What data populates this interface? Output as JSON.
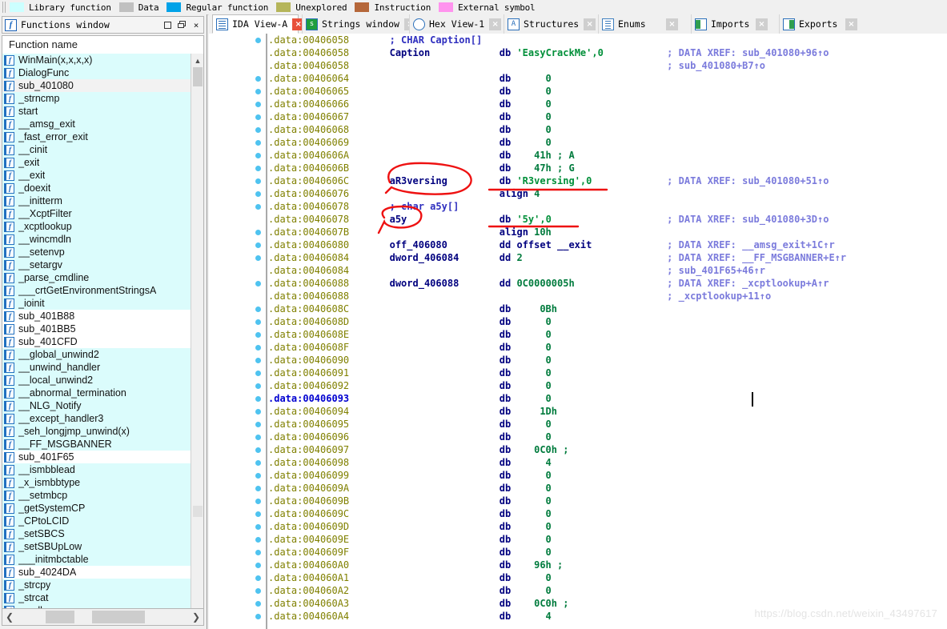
{
  "legend": {
    "items": [
      {
        "label": "Library function",
        "color": "#ccffff"
      },
      {
        "label": "Data",
        "color": "#c0c0c0"
      },
      {
        "label": "Regular function",
        "color": "#00a2e8"
      },
      {
        "label": "Unexplored",
        "color": "#b5b55a"
      },
      {
        "label": "Instruction",
        "color": "#b5673a"
      },
      {
        "label": "External symbol",
        "color": "#ff93ee"
      }
    ]
  },
  "functions_panel": {
    "title": "Functions window",
    "icon": "ida-f-icon",
    "window_buttons": [
      {
        "name": "maximize",
        "glyph": "square"
      },
      {
        "name": "restore",
        "glyph": "restore"
      },
      {
        "name": "close",
        "glyph": "×"
      }
    ],
    "column_header": "Function name",
    "rows": [
      {
        "name": "WinMain(x,x,x,x)",
        "kind": "lib"
      },
      {
        "name": "DialogFunc",
        "kind": "lib"
      },
      {
        "name": "sub_401080",
        "kind": "sel"
      },
      {
        "name": "_strncmp",
        "kind": "lib"
      },
      {
        "name": "start",
        "kind": "lib"
      },
      {
        "name": "__amsg_exit",
        "kind": "lib"
      },
      {
        "name": "_fast_error_exit",
        "kind": "lib"
      },
      {
        "name": "__cinit",
        "kind": "lib"
      },
      {
        "name": "_exit",
        "kind": "lib"
      },
      {
        "name": "__exit",
        "kind": "lib"
      },
      {
        "name": "_doexit",
        "kind": "lib"
      },
      {
        "name": "__initterm",
        "kind": "lib"
      },
      {
        "name": "__XcptFilter",
        "kind": "lib"
      },
      {
        "name": "_xcptlookup",
        "kind": "lib"
      },
      {
        "name": "__wincmdln",
        "kind": "lib"
      },
      {
        "name": "__setenvp",
        "kind": "lib"
      },
      {
        "name": "__setargv",
        "kind": "lib"
      },
      {
        "name": "_parse_cmdline",
        "kind": "lib"
      },
      {
        "name": "___crtGetEnvironmentStringsA",
        "kind": "lib"
      },
      {
        "name": "_ioinit",
        "kind": "lib"
      },
      {
        "name": "sub_401B88",
        "kind": "reg"
      },
      {
        "name": "sub_401BB5",
        "kind": "reg"
      },
      {
        "name": "sub_401CFD",
        "kind": "reg"
      },
      {
        "name": "__global_unwind2",
        "kind": "lib"
      },
      {
        "name": "__unwind_handler",
        "kind": "lib"
      },
      {
        "name": "__local_unwind2",
        "kind": "lib"
      },
      {
        "name": "__abnormal_termination",
        "kind": "lib"
      },
      {
        "name": "__NLG_Notify",
        "kind": "lib"
      },
      {
        "name": "__except_handler3",
        "kind": "lib"
      },
      {
        "name": "_seh_longjmp_unwind(x)",
        "kind": "lib"
      },
      {
        "name": "__FF_MSGBANNER",
        "kind": "lib"
      },
      {
        "name": "sub_401F65",
        "kind": "reg"
      },
      {
        "name": "__ismbblead",
        "kind": "lib"
      },
      {
        "name": "_x_ismbbtype",
        "kind": "lib"
      },
      {
        "name": "__setmbcp",
        "kind": "lib"
      },
      {
        "name": "_getSystemCP",
        "kind": "lib"
      },
      {
        "name": "_CPtoLCID",
        "kind": "lib"
      },
      {
        "name": "_setSBCS",
        "kind": "lib"
      },
      {
        "name": "_setSBUpLow",
        "kind": "lib"
      },
      {
        "name": "___initmbctable",
        "kind": "lib"
      },
      {
        "name": "sub_4024DA",
        "kind": "reg"
      },
      {
        "name": "_strcpy",
        "kind": "lib"
      },
      {
        "name": "_strcat",
        "kind": "lib"
      },
      {
        "name": "_malloc",
        "kind": "lib"
      }
    ]
  },
  "tabs": [
    {
      "label": "IDA View-A",
      "icon": "ico-doc",
      "active": true,
      "close": "×"
    },
    {
      "label": "Strings window",
      "icon": "ico-green",
      "active": false,
      "close": "×"
    },
    {
      "label": "Hex View-1",
      "icon": "ico-hex",
      "active": false,
      "close": "×"
    },
    {
      "label": "Structures",
      "icon": "ico-struct",
      "active": false,
      "close": "×"
    },
    {
      "label": "Enums",
      "icon": "ico-enum",
      "active": false,
      "close": "×"
    },
    {
      "label": "Imports",
      "icon": "ico-imp",
      "active": false,
      "close": "×"
    },
    {
      "label": "Exports",
      "icon": "ico-exp",
      "active": false,
      "close": "×"
    }
  ],
  "disassembly": {
    "lines": [
      {
        "dot": true,
        "addr": ".data:00406058",
        "label": "",
        "code": "; CHAR Caption[]",
        "code_class": "cmt",
        "xref": ""
      },
      {
        "dot": false,
        "addr": ".data:00406058",
        "label": "Caption",
        "mn": "db",
        "op": "'EasyCrackMe',0",
        "op_class": "str",
        "xref": "; DATA XREF: sub_401080+96↑o"
      },
      {
        "dot": false,
        "addr": ".data:00406058",
        "label": "",
        "code": "",
        "xref": "; sub_401080+B7↑o"
      },
      {
        "dot": true,
        "addr": ".data:00406064",
        "label": "",
        "mn": "db",
        "op": "0",
        "op_class": "num",
        "xref": ""
      },
      {
        "dot": true,
        "addr": ".data:00406065",
        "label": "",
        "mn": "db",
        "op": "0",
        "op_class": "num",
        "xref": ""
      },
      {
        "dot": true,
        "addr": ".data:00406066",
        "label": "",
        "mn": "db",
        "op": "0",
        "op_class": "num",
        "xref": ""
      },
      {
        "dot": true,
        "addr": ".data:00406067",
        "label": "",
        "mn": "db",
        "op": "0",
        "op_class": "num",
        "xref": ""
      },
      {
        "dot": true,
        "addr": ".data:00406068",
        "label": "",
        "mn": "db",
        "op": "0",
        "op_class": "num",
        "xref": ""
      },
      {
        "dot": true,
        "addr": ".data:00406069",
        "label": "",
        "mn": "db",
        "op": "0",
        "op_class": "num",
        "xref": ""
      },
      {
        "dot": true,
        "addr": ".data:0040606A",
        "label": "",
        "mn": "db",
        "op": "41h ; A",
        "op_class": "num",
        "xref": ""
      },
      {
        "dot": true,
        "addr": ".data:0040606B",
        "label": "",
        "mn": "db",
        "op": "47h ; G",
        "op_class": "num",
        "xref": ""
      },
      {
        "dot": true,
        "addr": ".data:0040606C",
        "label": "aR3versing",
        "mn": "db",
        "op": "'R3versing',0",
        "op_class": "str",
        "xref": "; DATA XREF: sub_401080+51↑o"
      },
      {
        "dot": true,
        "addr": ".data:00406076",
        "label": "",
        "mn": "align",
        "op": "4",
        "op_class": "plain",
        "xref": ""
      },
      {
        "dot": true,
        "addr": ".data:00406078",
        "label": "",
        "code": "; char a5y[]",
        "code_class": "cmt",
        "xref": ""
      },
      {
        "dot": false,
        "addr": ".data:00406078",
        "label": "a5y",
        "mn": "db",
        "op": "'5y',0",
        "op_class": "str",
        "xref": "; DATA XREF: sub_401080+3D↑o"
      },
      {
        "dot": true,
        "addr": ".data:0040607B",
        "label": "",
        "mn": "align",
        "op": "10h",
        "op_class": "plain",
        "xref": ""
      },
      {
        "dot": true,
        "addr": ".data:00406080",
        "label": "off_406080",
        "mn": "dd offset",
        "op": "__exit",
        "op_class": "lbl",
        "xref": "; DATA XREF: __amsg_exit+1C↑r"
      },
      {
        "dot": true,
        "addr": ".data:00406084",
        "label": "dword_406084",
        "mn": "dd",
        "op": "2",
        "op_class": "num",
        "xref": "; DATA XREF: __FF_MSGBANNER+E↑r"
      },
      {
        "dot": false,
        "addr": ".data:00406084",
        "label": "",
        "code": "",
        "xref": "; sub_401F65+46↑r"
      },
      {
        "dot": true,
        "addr": ".data:00406088",
        "label": "dword_406088",
        "mn": "dd",
        "op": "0C0000005h",
        "op_class": "num",
        "xref": "; DATA XREF: _xcptlookup+A↑r"
      },
      {
        "dot": false,
        "addr": ".data:00406088",
        "label": "",
        "code": "",
        "xref": "; _xcptlookup+11↑o"
      },
      {
        "dot": true,
        "addr": ".data:0040608C",
        "label": "",
        "mn": "db",
        "op": "0Bh",
        "op_class": "num",
        "xref": ""
      },
      {
        "dot": true,
        "addr": ".data:0040608D",
        "label": "",
        "mn": "db",
        "op": "0",
        "op_class": "num",
        "xref": ""
      },
      {
        "dot": true,
        "addr": ".data:0040608E",
        "label": "",
        "mn": "db",
        "op": "0",
        "op_class": "num",
        "xref": ""
      },
      {
        "dot": true,
        "addr": ".data:0040608F",
        "label": "",
        "mn": "db",
        "op": "0",
        "op_class": "num",
        "xref": ""
      },
      {
        "dot": true,
        "addr": ".data:00406090",
        "label": "",
        "mn": "db",
        "op": "0",
        "op_class": "num",
        "xref": ""
      },
      {
        "dot": true,
        "addr": ".data:00406091",
        "label": "",
        "mn": "db",
        "op": "0",
        "op_class": "num",
        "xref": ""
      },
      {
        "dot": true,
        "addr": ".data:00406092",
        "label": "",
        "mn": "db",
        "op": "0",
        "op_class": "num",
        "xref": ""
      },
      {
        "dot": true,
        "addr": ".data:00406093",
        "label": "",
        "mn": "db",
        "op": "0",
        "op_class": "num",
        "xref": "",
        "current": true
      },
      {
        "dot": true,
        "addr": ".data:00406094",
        "label": "",
        "mn": "db",
        "op": "1Dh",
        "op_class": "num",
        "xref": ""
      },
      {
        "dot": true,
        "addr": ".data:00406095",
        "label": "",
        "mn": "db",
        "op": "0",
        "op_class": "num",
        "xref": ""
      },
      {
        "dot": true,
        "addr": ".data:00406096",
        "label": "",
        "mn": "db",
        "op": "0",
        "op_class": "num",
        "xref": ""
      },
      {
        "dot": true,
        "addr": ".data:00406097",
        "label": "",
        "mn": "db",
        "op": "0C0h ;",
        "op_class": "num",
        "xref": ""
      },
      {
        "dot": true,
        "addr": ".data:00406098",
        "label": "",
        "mn": "db",
        "op": "4",
        "op_class": "num",
        "xref": ""
      },
      {
        "dot": true,
        "addr": ".data:00406099",
        "label": "",
        "mn": "db",
        "op": "0",
        "op_class": "num",
        "xref": ""
      },
      {
        "dot": true,
        "addr": ".data:0040609A",
        "label": "",
        "mn": "db",
        "op": "0",
        "op_class": "num",
        "xref": ""
      },
      {
        "dot": true,
        "addr": ".data:0040609B",
        "label": "",
        "mn": "db",
        "op": "0",
        "op_class": "num",
        "xref": ""
      },
      {
        "dot": true,
        "addr": ".data:0040609C",
        "label": "",
        "mn": "db",
        "op": "0",
        "op_class": "num",
        "xref": ""
      },
      {
        "dot": true,
        "addr": ".data:0040609D",
        "label": "",
        "mn": "db",
        "op": "0",
        "op_class": "num",
        "xref": ""
      },
      {
        "dot": true,
        "addr": ".data:0040609E",
        "label": "",
        "mn": "db",
        "op": "0",
        "op_class": "num",
        "xref": ""
      },
      {
        "dot": true,
        "addr": ".data:0040609F",
        "label": "",
        "mn": "db",
        "op": "0",
        "op_class": "num",
        "xref": ""
      },
      {
        "dot": true,
        "addr": ".data:004060A0",
        "label": "",
        "mn": "db",
        "op": "96h ;",
        "op_class": "num",
        "xref": ""
      },
      {
        "dot": true,
        "addr": ".data:004060A1",
        "label": "",
        "mn": "db",
        "op": "0",
        "op_class": "num",
        "xref": ""
      },
      {
        "dot": true,
        "addr": ".data:004060A2",
        "label": "",
        "mn": "db",
        "op": "0",
        "op_class": "num",
        "xref": ""
      },
      {
        "dot": true,
        "addr": ".data:004060A3",
        "label": "",
        "mn": "db",
        "op": "0C0h ;",
        "op_class": "num",
        "xref": ""
      },
      {
        "dot": true,
        "addr": ".data:004060A4",
        "label": "",
        "mn": "db",
        "op": "4",
        "op_class": "num",
        "xref": ""
      }
    ]
  },
  "annotations": {
    "color": "#ee1111",
    "marks": [
      {
        "type": "ellipse",
        "target": "aR3versing"
      },
      {
        "type": "ellipse",
        "target": "a5y"
      },
      {
        "type": "underline",
        "target": "R3versing-string"
      },
      {
        "type": "underline",
        "target": "5y-string"
      }
    ]
  },
  "watermark": "https://blog.csdn.net/weixin_43497617"
}
